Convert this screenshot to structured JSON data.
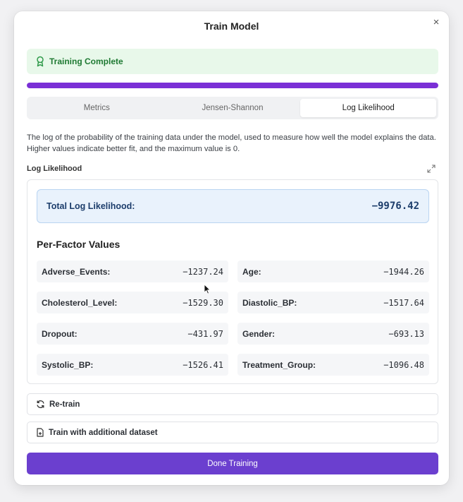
{
  "dialog": {
    "title": "Train Model",
    "close_glyph": "×"
  },
  "alert": {
    "icon": "award-icon",
    "text": "Training Complete",
    "color": "#1f7a33"
  },
  "progress": {
    "percent": 100,
    "color": "#7a2fd6"
  },
  "tabs": [
    {
      "label": "Metrics",
      "active": false
    },
    {
      "label": "Jensen-Shannon",
      "active": false
    },
    {
      "label": "Log Likelihood",
      "active": true
    }
  ],
  "description": "The log of the probability of the training data under the model, used to measure how well the model explains the data. Higher values indicate better fit, and the maximum value is 0.",
  "section_label": "Log Likelihood",
  "total": {
    "label": "Total Log Likelihood:",
    "value": "−9976.42"
  },
  "per_factor": {
    "title": "Per-Factor Values",
    "items": [
      {
        "name": "Adverse_Events:",
        "value": "−1237.24"
      },
      {
        "name": "Age:",
        "value": "−1944.26"
      },
      {
        "name": "Cholesterol_Level:",
        "value": "−1529.30"
      },
      {
        "name": "Diastolic_BP:",
        "value": "−1517.64"
      },
      {
        "name": "Dropout:",
        "value": "−431.97"
      },
      {
        "name": "Gender:",
        "value": "−693.13"
      },
      {
        "name": "Systolic_BP:",
        "value": "−1526.41"
      },
      {
        "name": "Treatment_Group:",
        "value": "−1096.48"
      }
    ]
  },
  "actions": {
    "retrain_label": "Re-train",
    "retrain_icon": "refresh-icon",
    "additional_label": "Train with additional dataset",
    "additional_icon": "file-plus-icon",
    "done_label": "Done Training",
    "primary_color": "#6b3fcf"
  }
}
